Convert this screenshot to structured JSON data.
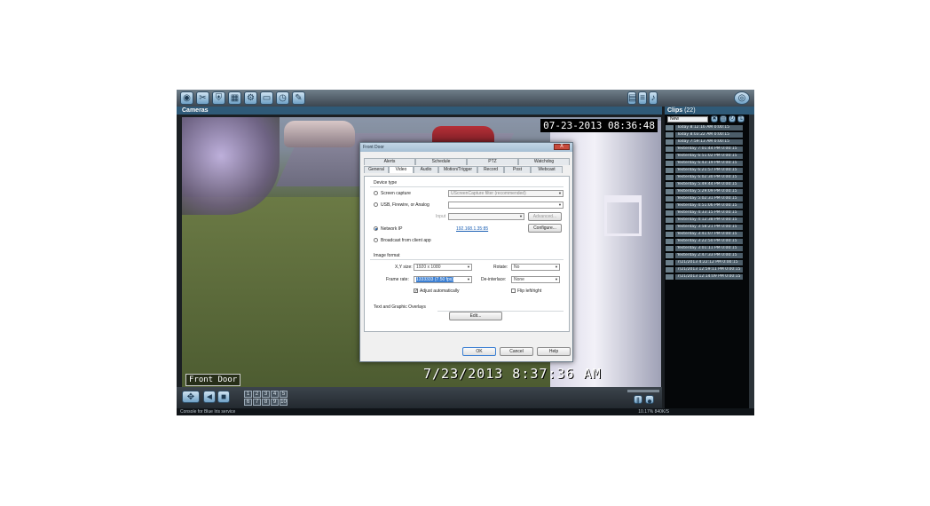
{
  "toolbar": {
    "icons": [
      "camera-icon",
      "tools-icon",
      "shield-icon",
      "grid-icon",
      "settings-icon",
      "monitor-icon",
      "clock-icon",
      "edit-icon"
    ]
  },
  "cameras_panel": {
    "title": "Cameras"
  },
  "clips_panel": {
    "title": "Clips",
    "count": "(22)",
    "filter": "New",
    "items": [
      "Today 8:12:16 AM 0:00:15",
      "Today 8:03:22 AM 0:00:15",
      "Today 7:59:13 AM 0:00:15",
      "Yesterday 7:01:44 PM 0:00:15",
      "Yesterday 6:51:02 PM 0:00:15",
      "Yesterday 6:43:19 PM 0:00:15",
      "Yesterday 6:21:57 PM 0:00:15",
      "Yesterday 6:02:30 PM 0:00:15",
      "Yesterday 5:49:44 PM 0:00:15",
      "Yesterday 5:29:09 PM 0:00:15",
      "Yesterday 5:02:31 PM 0:00:15",
      "Yesterday 4:51:06 PM 0:00:15",
      "Yesterday 4:33:15 PM 0:00:15",
      "Yesterday 4:12:38 PM 0:00:15",
      "Yesterday 3:58:21 PM 0:00:15",
      "Yesterday 3:41:07 PM 0:00:15",
      "Yesterday 3:22:50 PM 0:00:15",
      "Yesterday 3:01:11 PM 0:00:15",
      "Yesterday 2:47:33 PM 0:00:15",
      "7/21/2013 4:22:12 PM 0:00:15",
      "7/21/2013 12:59:11 PM 0:00:15",
      "7/21/2013 12:14:09 PM 0:00:15"
    ]
  },
  "video": {
    "timestamp_top": "07-23-2013 08:36:48",
    "timestamp_bottom": "7/23/2013 8:37:36 AM",
    "camera_name": "Front Door"
  },
  "camera_buttons": [
    "1",
    "2",
    "3",
    "4",
    "5",
    "6",
    "7",
    "8",
    "9",
    "10"
  ],
  "statusbar": {
    "left": "Console for Blue Iris service",
    "right": "10.17% 840K/S"
  },
  "dialog": {
    "title": "Front Door",
    "close": "X",
    "tabs_row1": [
      "Alerts",
      "Schedule",
      "PTZ",
      "Watchdog"
    ],
    "tabs_row2": [
      "General",
      "Video",
      "Audio",
      "Motion/Trigger",
      "Record",
      "Post",
      "Webcast"
    ],
    "active_tab": "Video",
    "device_type_label": "Device type",
    "screen_capture": "Screen capture",
    "screen_capture_select": "UScreenCapture filter (recommended)",
    "usb_label": "USB, Firewire, or Analog",
    "input_label": "Input",
    "advanced_button": "Advanced...",
    "network_ip": "Network IP",
    "ip_address": "192.168.1.35:85",
    "configure_button": "Configure...",
    "broadcast": "Broadcast from client app",
    "image_format_label": "Image format",
    "xy_size_label": "X,Y size:",
    "xy_size_value": "1920 x 1080",
    "frame_rate_label": "Frame rate:",
    "frame_rate_value": "1333333 (7.50 fps)",
    "adjust_auto": "Adjust automatically",
    "rotate_label": "Rotate:",
    "rotate_value": "No",
    "deinterlace_label": "De-interlace:",
    "deinterlace_value": "None",
    "flip_label": "Flip left/right",
    "overlays_label": "Text and Graphic Overlays",
    "edit_button": "Edit...",
    "ok_button": "OK",
    "cancel_button": "Cancel",
    "help_button": "Help"
  }
}
